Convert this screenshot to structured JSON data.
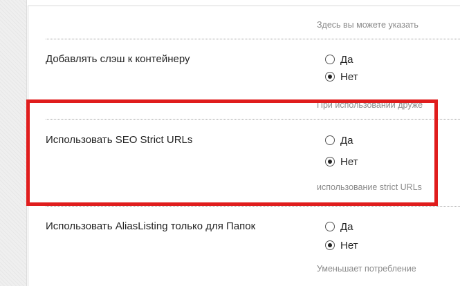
{
  "help_top": "Здесь вы можете указать",
  "settings": [
    {
      "label": "Добавлять слэш к контейнеру",
      "options": [
        {
          "label": "Да",
          "checked": false
        },
        {
          "label": "Нет",
          "checked": true
        }
      ],
      "help": "При использовании друже"
    },
    {
      "label": "Использовать SEO Strict URLs",
      "options": [
        {
          "label": "Да",
          "checked": false
        },
        {
          "label": "Нет",
          "checked": true
        }
      ],
      "help": "использование strict URLs"
    },
    {
      "label": "Использовать AliasListing только для Папок",
      "options": [
        {
          "label": "Да",
          "checked": false
        },
        {
          "label": "Нет",
          "checked": true
        }
      ],
      "help": "Уменьшает потребление"
    }
  ],
  "colors": {
    "highlight": "#e01d1d",
    "help_text": "#8a8a8a"
  }
}
